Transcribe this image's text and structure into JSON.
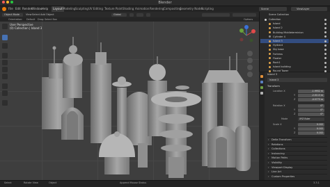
{
  "window": {
    "title": "Blender"
  },
  "menu": [
    "File",
    "Edit",
    "Render",
    "Window",
    "Help"
  ],
  "workspaces": [
    "Layout",
    "Modeling",
    "Sculpting",
    "UV Editing",
    "Texture Paint",
    "Shading",
    "Animation",
    "Rendering",
    "Compositing",
    "Geometry Nodes",
    "Scripting"
  ],
  "active_workspace": "Layout",
  "scene": {
    "label": "Scene",
    "view_layer": "ViewLayer"
  },
  "toolbar": {
    "mode": "Object Mode",
    "menus": [
      "View",
      "Select",
      "Add",
      "Object"
    ],
    "transform": "Global",
    "orientation_label": "Orientation:",
    "orientation_value": "Default",
    "drag_label": "Drag:",
    "drag_value": "Select Box",
    "options": "Options"
  },
  "viewport": {
    "line1": "User Perspective",
    "line2": "(0) Collection | Island 3"
  },
  "left_tools": [
    "cursor",
    "select",
    "move",
    "rotate",
    "scale",
    "transform",
    "annotate",
    "measure",
    "add-cube"
  ],
  "outliner": {
    "header": "Scene Collection",
    "rows": [
      {
        "name": "Collection",
        "level": 0,
        "selected": false,
        "color": "#cfcfcf"
      },
      {
        "name": "Island",
        "level": 1,
        "selected": false,
        "color": "#e2a64b"
      },
      {
        "name": "Island 2",
        "level": 1,
        "selected": false,
        "color": "#e2a64b"
      },
      {
        "name": "Building Middleterminion",
        "level": 1,
        "selected": false,
        "color": "#e2a64b"
      },
      {
        "name": "Cylinder 4",
        "level": 1,
        "selected": false,
        "color": "#8c8c8c"
      },
      {
        "name": "Island 3",
        "level": 1,
        "selected": true,
        "color": "#e2a64b"
      },
      {
        "name": "Hydrant",
        "level": 1,
        "selected": false,
        "color": "#e2a64b"
      },
      {
        "name": "Sky base",
        "level": 1,
        "selected": false,
        "color": "#e2a64b"
      },
      {
        "name": "Fortress",
        "level": 1,
        "selected": false,
        "color": "#e2a64b"
      },
      {
        "name": "Floater",
        "level": 1,
        "selected": false,
        "color": "#e2a64b"
      },
      {
        "name": "Rock1",
        "level": 1,
        "selected": false,
        "color": "#e2a64b"
      },
      {
        "name": "Island building",
        "level": 1,
        "selected": false,
        "color": "#e2a64b"
      },
      {
        "name": "Round Tower",
        "level": 1,
        "selected": false,
        "color": "#e2a64b"
      }
    ]
  },
  "properties": {
    "object_name": "Island 3",
    "sub_name": "Island 3",
    "transform_label": "Transform",
    "location_label": "Location X",
    "location": [
      "-1.9952 m",
      "-2.0113 m",
      "-0.5773 m"
    ],
    "axis_y": "Y",
    "axis_z": "Z",
    "rotation_label": "Rotation X",
    "rotation": [
      "0°",
      "0°",
      "0°"
    ],
    "mode_label": "Mode",
    "mode_value": "XYZ Euler",
    "scale_label": "Scale X",
    "scale": [
      "0.102",
      "0.102",
      "0.102"
    ],
    "panels": [
      "Delta Transform",
      "Relations",
      "Collections",
      "Instancing",
      "Motion Paths",
      "Visibility",
      "Viewport Display",
      "Line Art",
      "Custom Properties"
    ]
  },
  "statusbar": {
    "left": "Select",
    "mid1": "Rotate View",
    "mid2": "Object",
    "center": "Append Mouse Status",
    "right": "3.3.1"
  }
}
